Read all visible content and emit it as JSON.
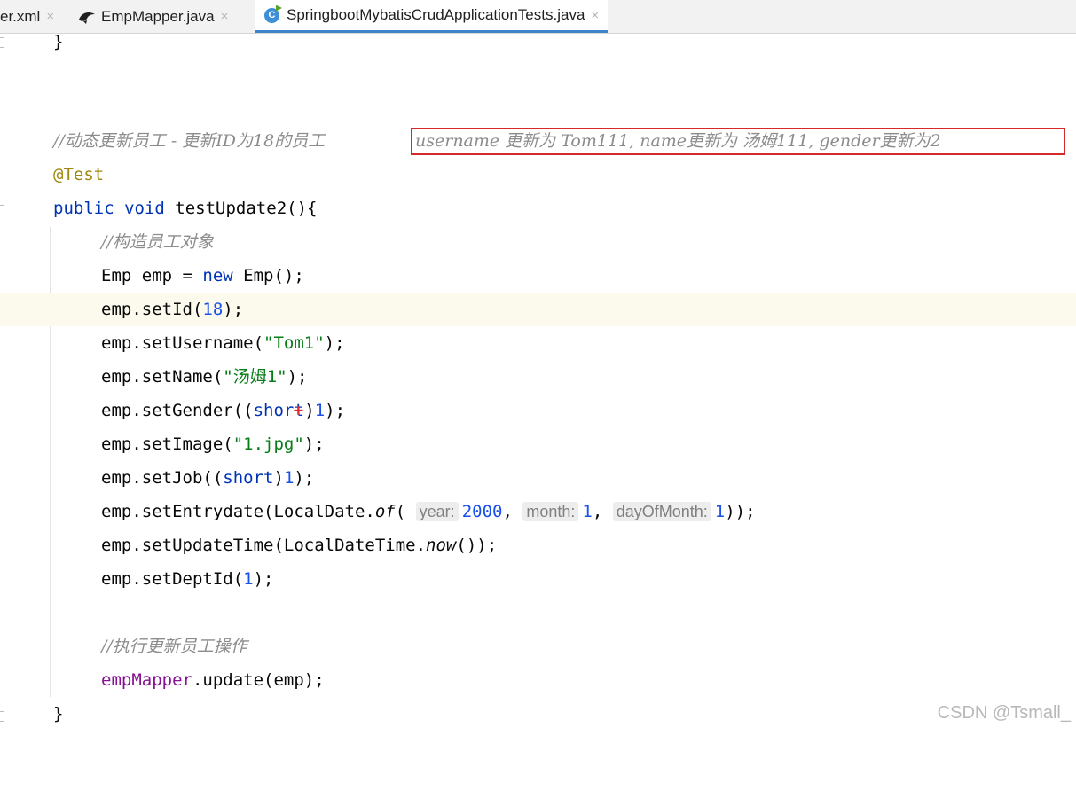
{
  "tabs": [
    {
      "label": "er.xml",
      "active": false
    },
    {
      "label": "EmpMapper.java",
      "active": false
    },
    {
      "label": "SpringbootMybatisCrudApplicationTests.java",
      "active": true
    }
  ],
  "tab_close_glyph": "×",
  "class_icon_letter": "C",
  "code": {
    "l0_brace": "}",
    "l1_comment": "//动态更新员工 - 更新ID为18的员工 ",
    "l1_boxed": "username 更新为 Tom111, name更新为 汤姆111, gender更新为2",
    "l2_annotation": "@Test",
    "l3_public": "public",
    "l3_void": "void",
    "l3_sig": " testUpdate2(){",
    "l4_comment": "//构造员工对象",
    "l5_a": "Emp emp = ",
    "l5_new": "new",
    "l5_b": " Emp();",
    "l6_a": "emp.setId(",
    "l6_num": "18",
    "l6_b": ");",
    "l7_a": "emp.setUsername(",
    "l7_str": "\"Tom1\"",
    "l7_b": ");",
    "l8_a": "emp.setName(",
    "l8_str": "\"汤姆1\"",
    "l8_b": ");",
    "l9_a": "emp.setGender((",
    "l9_kw": "short",
    "l9_mark": "+",
    "l9_b": ")",
    "l9_num": "1",
    "l9_c": ");",
    "l10_a": "emp.setImage(",
    "l10_str": "\"1.jpg\"",
    "l10_b": ");",
    "l11_a": "emp.setJob((",
    "l11_kw": "short",
    "l11_b": ")",
    "l11_num": "1",
    "l11_c": ");",
    "l12_a": "emp.setEntrydate(LocalDate.",
    "l12_of": "of",
    "l12_paren": "(",
    "l12_hint_year": "year:",
    "l12_year": "2000",
    "l12_comma1": ", ",
    "l12_hint_month": "month:",
    "l12_month": "1",
    "l12_comma2": ", ",
    "l12_hint_day": "dayOfMonth:",
    "l12_day": "1",
    "l12_end": "));",
    "l13_a": "emp.setUpdateTime(LocalDateTime.",
    "l13_now": "now",
    "l13_b": "());",
    "l14_a": "emp.setDeptId(",
    "l14_num": "1",
    "l14_b": ");",
    "l16_comment": "//执行更新员工操作",
    "l17_field": "empMapper",
    "l17_b": ".update(emp);",
    "l18_brace": "}"
  },
  "watermark": "CSDN @Tsmall_",
  "colors": {
    "keyword": "#0033b3",
    "number": "#1750eb",
    "string": "#067d17",
    "comment": "#8c8c8c",
    "annotation": "#9e880d",
    "field": "#871094",
    "highlight_box": "#d42a2a",
    "active_tab_underline": "#4083c9"
  }
}
